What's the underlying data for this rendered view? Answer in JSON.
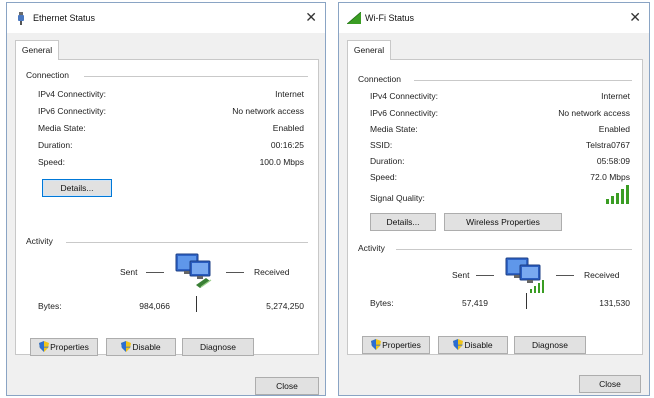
{
  "ethernet": {
    "title": "Ethernet Status",
    "tab": "General",
    "connection_label": "Connection",
    "rows": [
      {
        "label": "IPv4 Connectivity:",
        "value": "Internet"
      },
      {
        "label": "IPv6 Connectivity:",
        "value": "No network access"
      },
      {
        "label": "Media State:",
        "value": "Enabled"
      },
      {
        "label": "Duration:",
        "value": "00:16:25"
      },
      {
        "label": "Speed:",
        "value": "100.0 Mbps"
      }
    ],
    "details_button": "Details...",
    "activity_label": "Activity",
    "sent_label": "Sent",
    "received_label": "Received",
    "bytes_label": "Bytes:",
    "bytes_sent": "984,066",
    "bytes_received": "5,274,250",
    "properties_button": "Properties",
    "disable_button": "Disable",
    "diagnose_button": "Diagnose",
    "close_button": "Close"
  },
  "wifi": {
    "title": "Wi-Fi Status",
    "tab": "General",
    "connection_label": "Connection",
    "rows": [
      {
        "label": "IPv4 Connectivity:",
        "value": "Internet"
      },
      {
        "label": "IPv6 Connectivity:",
        "value": "No network access"
      },
      {
        "label": "Media State:",
        "value": "Enabled"
      },
      {
        "label": "SSID:",
        "value": "Telstra0767"
      },
      {
        "label": "Duration:",
        "value": "05:58:09"
      },
      {
        "label": "Speed:",
        "value": "72.0 Mbps"
      }
    ],
    "signal_quality_label": "Signal Quality:",
    "signal_bars_lit": 5,
    "details_button": "Details...",
    "wireless_properties_button": "Wireless Properties",
    "activity_label": "Activity",
    "sent_label": "Sent",
    "received_label": "Received",
    "bytes_label": "Bytes:",
    "bytes_sent": "57,419",
    "bytes_received": "131,530",
    "properties_button": "Properties",
    "disable_button": "Disable",
    "diagnose_button": "Diagnose",
    "close_button": "Close"
  },
  "icons": {
    "ethernet_title": "ethernet-cable-icon",
    "wifi_title": "wifi-signal-icon",
    "close": "close-icon",
    "shield": "uac-shield-icon",
    "network_activity": "network-computers-icon",
    "signal_quality": "signal-strength-icon"
  },
  "colors": {
    "accent_focus": "#0078d7",
    "signal_green": "#3a9d23",
    "window_border": "#8aa4c4"
  }
}
